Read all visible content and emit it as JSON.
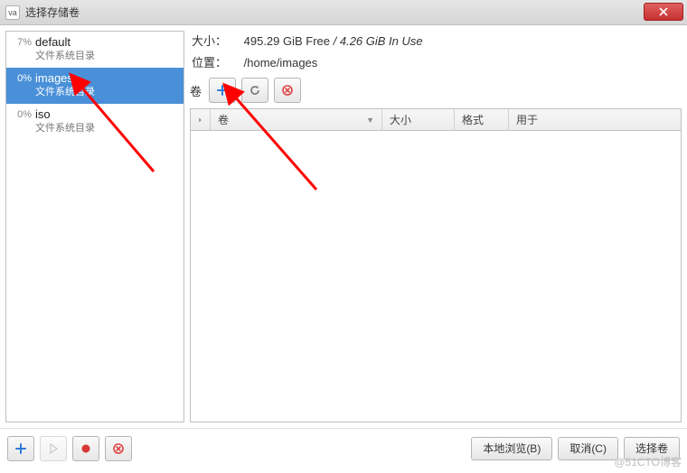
{
  "window": {
    "title": "选择存储卷",
    "app_icon_char": "va"
  },
  "pools": [
    {
      "pct": "7%",
      "name": "default",
      "type": "文件系统目录",
      "selected": false
    },
    {
      "pct": "0%",
      "name": "images",
      "type": "文件系统目录",
      "selected": true
    },
    {
      "pct": "0%",
      "name": "iso",
      "type": "文件系统目录",
      "selected": false
    }
  ],
  "info": {
    "size_label": "大小：",
    "size_value": "495.29 GiB Free / 4.26 GiB In Use",
    "location_label": "位置：",
    "location_value": "/home/images"
  },
  "volume_section_label": "卷",
  "table": {
    "columns": {
      "vol": "卷",
      "size": "大小",
      "format": "格式",
      "used_for": "用于"
    }
  },
  "footer_buttons": {
    "local_browse": "本地浏览(B)",
    "cancel": "取消(C)",
    "choose": "选择卷"
  },
  "watermark": "@51CTO博客"
}
